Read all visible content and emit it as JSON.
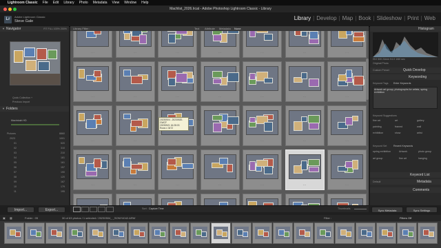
{
  "menubar": {
    "app": "Lightroom Classic",
    "items": [
      "File",
      "Edit",
      "Library",
      "Photo",
      "Metadata",
      "View",
      "Window",
      "Help"
    ]
  },
  "window": {
    "title": "Machlist_2026.lrcat - Adobe Photoshop Lightroom Classic - Library",
    "traffic_lights": [
      "#ff5f57",
      "#febc2e",
      "#28c840"
    ]
  },
  "identity": {
    "badge": "Lr",
    "line1": "Adobe Lightroom Classic",
    "line2": "Steve Gale"
  },
  "modules": {
    "items": [
      "Library",
      "Develop",
      "Map",
      "Book",
      "Slideshow",
      "Print",
      "Web"
    ],
    "active": "Library"
  },
  "left_panel": {
    "navigator": {
      "title": "Navigator",
      "zoom_options": "FIT  FILL  100%  200%"
    },
    "catalog_rows": [
      "Quick Collection +",
      "Previous Import"
    ],
    "folders": {
      "title": "Folders",
      "volume": "Macintosh HD",
      "tree": [
        "Pictures",
        "2023",
        "01",
        "02",
        "03",
        "04",
        "05",
        "06",
        "07",
        "08",
        "09",
        "10",
        "11"
      ],
      "counts": [
        "8860",
        "1001",
        "520",
        "310",
        "210",
        "181",
        "161",
        "157",
        "190",
        "120",
        "167",
        "179",
        "195"
      ]
    },
    "import_button": "Import...",
    "export_button": "Export..."
  },
  "grid_header": {
    "label": "Library Filter :",
    "tabs": [
      "Text",
      "Attribute",
      "Metadata",
      "None"
    ]
  },
  "tooltip": {
    "lines": [
      "20230504 - 20230520-GWCF",
      "20230521 16:28:03",
      "Rows x 3472"
    ]
  },
  "toolbar": {
    "sort_label": "Sort:",
    "sort_value": "Capture Time",
    "thumbnails_label": "Thumbnails"
  },
  "right_panel": {
    "histogram": {
      "title": "Histogram",
      "info": "ISO 500  24mm  f/4.0  1/60 sec",
      "original": "Original Photo"
    },
    "quick_develop": {
      "title": "Quick Develop",
      "preset": "Custom Preset"
    },
    "keywording": {
      "title": "Keywording",
      "tags_label": "Keyword Tags",
      "tags_mode": "Enter Keywords",
      "tags_text": "Artwork art group, photographs for artists, spring exhibition",
      "suggestions_title": "Keyword Suggestions",
      "suggestions": [
        "fine art",
        "art",
        "gallery",
        "painting",
        "framed",
        "wall",
        "exhibition",
        "show",
        "artist"
      ],
      "set_label": "Keyword Set",
      "set_value": "Recent Keywords",
      "set_words": [
        "spring exhibition",
        "Artwork",
        "photo group",
        "art group",
        "fine art",
        "hanging"
      ]
    },
    "keyword_list": {
      "title": "Keyword List"
    },
    "metadata": {
      "title": "Metadata",
      "preset": "Default"
    },
    "comments": {
      "title": "Comments"
    },
    "sync_button": "Sync Metadata",
    "sync_settings": "Sync Settings"
  },
  "filmbar": {
    "folder_text": "Folder : 05",
    "count_text": "30 of 63 photos / 1 selected / 20230504_ _SONY4042.ARW",
    "filter_label": "Filter :",
    "filter_value": "Filters Off"
  },
  "grid": {
    "columns": 7,
    "visible_rows": 4,
    "selected_index": 26,
    "tile_tone": "#8d8d8d",
    "selected_tone": "#d8d8d8"
  }
}
